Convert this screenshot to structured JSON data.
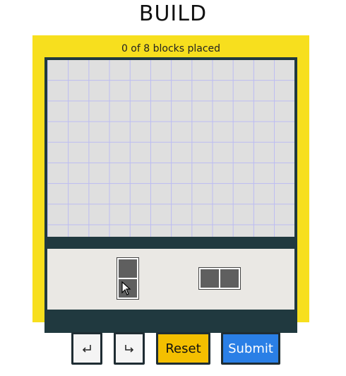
{
  "title": "BUILD",
  "status_text": "0 of 8 blocks placed",
  "colors": {
    "frame": "#f7df1e",
    "board_border": "#20393f",
    "grid_background": "#dfdfdf",
    "grid_lines": "#bcbcf2",
    "tray": "#eae8e4",
    "block": "#5f5f5f",
    "reset_button": "#f4bf00",
    "submit_button": "#2a7fe6"
  },
  "tray": {
    "pieces": [
      {
        "name": "vertical-domino",
        "orientation": "vertical",
        "cells": 2
      },
      {
        "name": "horizontal-domino",
        "orientation": "horizontal",
        "cells": 2
      }
    ]
  },
  "buttons": {
    "undo_icon": "undo-arrow-icon",
    "redo_icon": "redo-arrow-icon",
    "reset_label": "Reset",
    "submit_label": "Submit"
  }
}
